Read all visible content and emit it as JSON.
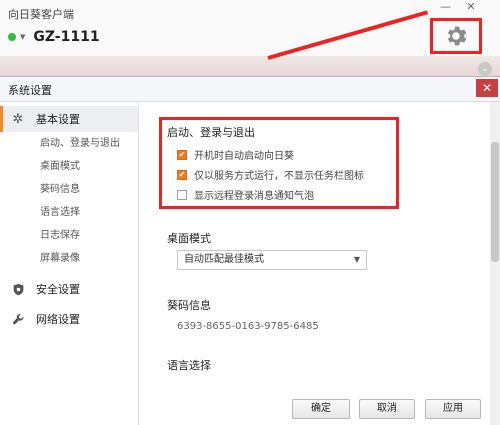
{
  "app": {
    "title": "向日葵客户端",
    "minimize": "—",
    "close": "✕",
    "device_id": "GZ-1111",
    "settings_icon": "gear-icon",
    "collapse_icon": "chevron-down-icon"
  },
  "dialog": {
    "title": "系统设置",
    "close": "✕"
  },
  "sidebar": {
    "groups": [
      {
        "label": "基本设置",
        "icon": "gear-icon",
        "active": true
      },
      {
        "label": "安全设置",
        "icon": "shield-icon"
      },
      {
        "label": "网络设置",
        "icon": "wrench-icon"
      }
    ],
    "sub_items": [
      "启动、登录与退出",
      "桌面模式",
      "葵码信息",
      "语言选择",
      "日志保存",
      "屏幕录像"
    ]
  },
  "main": {
    "startup": {
      "title": "启动、登录与退出",
      "options": [
        {
          "label": "开机时自动启动向日葵",
          "checked": true
        },
        {
          "label": "仅以服务方式运行，不显示任务栏图标",
          "checked": true
        },
        {
          "label": "显示远程登录消息通知气泡",
          "checked": false
        }
      ]
    },
    "desktop_mode": {
      "title": "桌面模式",
      "selected": "自动匹配最佳模式"
    },
    "code_info": {
      "title": "葵码信息",
      "value": "6393-8655-0163-9785-6485"
    },
    "language": {
      "title": "语言选择"
    }
  },
  "buttons": {
    "ok": "确定",
    "cancel": "取消",
    "apply": "应用"
  },
  "colors": {
    "accent": "#f07a20",
    "annotation_red": "#e22222",
    "online": "#2fbf3a"
  }
}
